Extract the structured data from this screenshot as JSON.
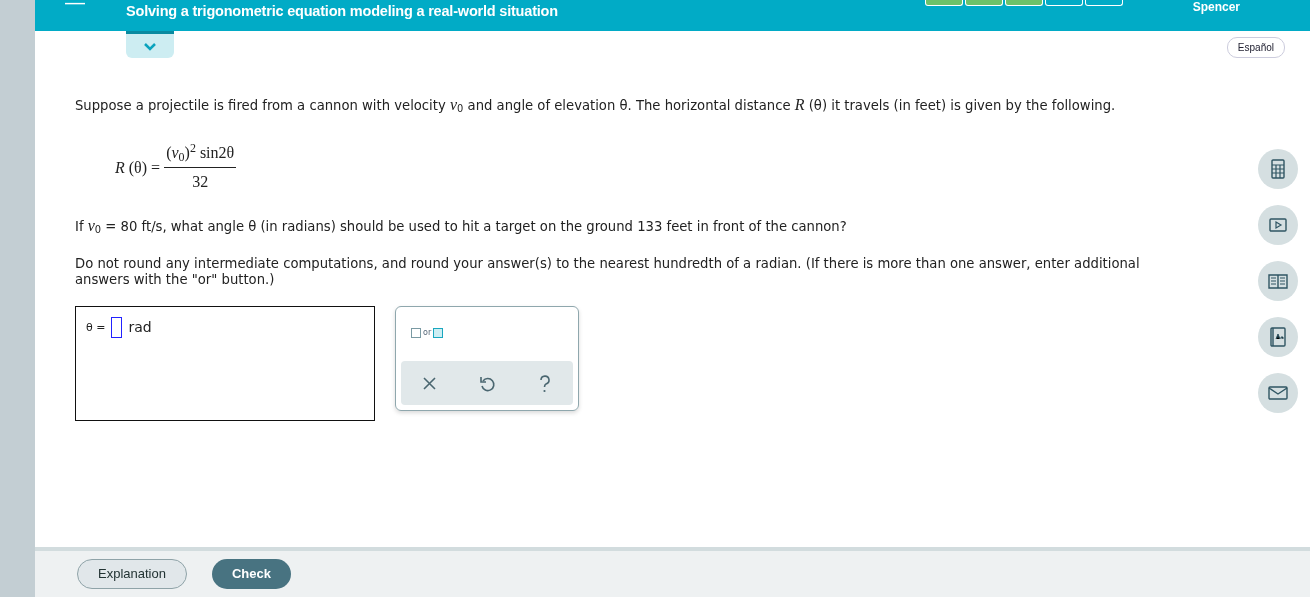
{
  "header": {
    "menu_icon": "—",
    "title": "Solving a trigonometric equation modeling a real-world situation",
    "user": "Spencer",
    "progress": [
      {
        "filled": true
      },
      {
        "filled": true
      },
      {
        "filled": true
      },
      {
        "filled": false
      },
      {
        "filled": false
      }
    ]
  },
  "language_button": "Español",
  "problem": {
    "intro": "Suppose a projectile is fired from a cannon with velocity *v*$_{0}$ and angle of elevation θ. The horizontal distance *R* (θ) it travels (in feet) is given by the following.",
    "formula": {
      "lhs": "*R* (θ) =",
      "numerator": "(*v*$_{0}$)$^{2}$ sin2θ",
      "denominator": "32"
    },
    "question": "If *v*$_{0}$ = 80 ft/s, what angle θ (in radians) should be used to hit a target on the ground 133 feet in front of the cannon?",
    "instructions": "Do not round any intermediate computations, and round your answer(s) to the nearest hundredth of a radian. (If there is more than one answer, enter additional answers with the \"or\" button.)"
  },
  "answer": {
    "label": "θ =",
    "unit": "rad"
  },
  "keypad": {
    "or_label": "or"
  },
  "tools": [
    {
      "kind": "calculator"
    },
    {
      "kind": "video"
    },
    {
      "kind": "ebook"
    },
    {
      "kind": "glossary"
    },
    {
      "kind": "message"
    }
  ],
  "footer": {
    "explanation": "Explanation",
    "check": "Check"
  }
}
